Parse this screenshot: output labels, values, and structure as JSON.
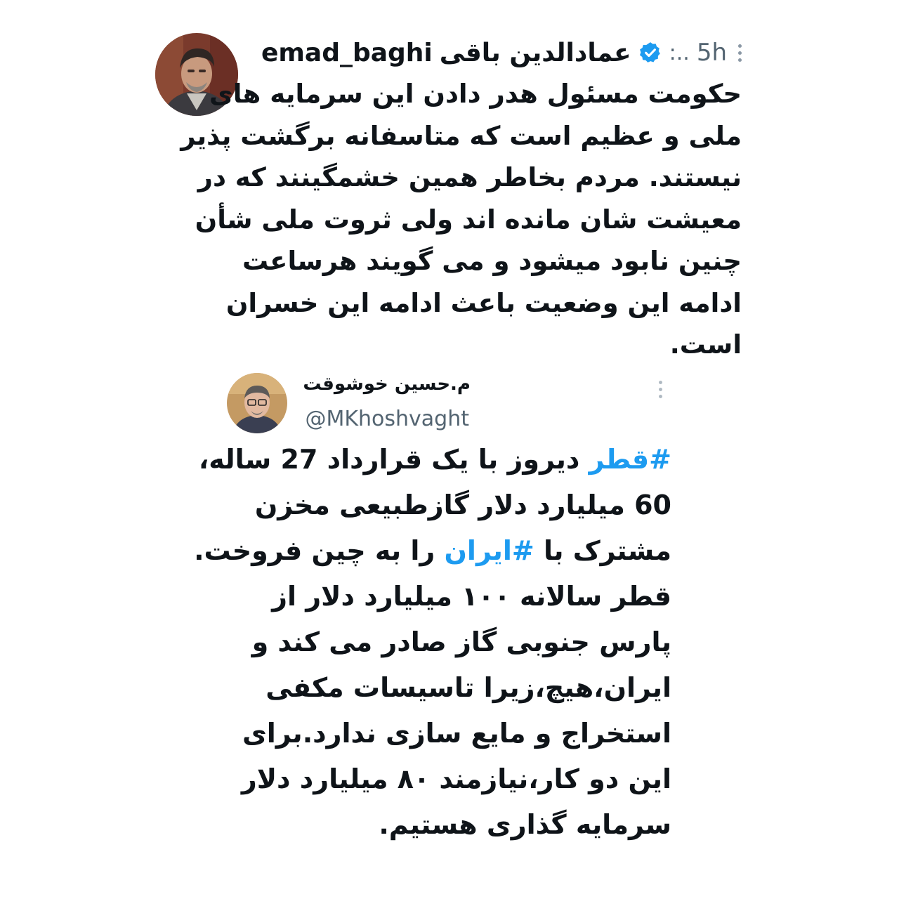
{
  "tweet": {
    "handle": "emad_baghi",
    "display_name": "عمادالدین باقی",
    "dots": ":..",
    "time": "5h",
    "lines": [
      "حکومت مسئول هدر دادن این سرمایه های",
      "ملی و عظیم است که متاسفانه برگشت پذیر",
      "نیستند. مردم بخاطر همین خشمگینند که در",
      "معیشت شان مانده اند ولی ثروت ملی شأن",
      "چنین نابود میشود و می گویند هرساعت",
      "ادامه این وضعیت باعث ادامه این خسران",
      "است."
    ]
  },
  "quoted_tweet": {
    "display_name": "م.حسین خوشوقت",
    "handle": "@MKhoshvaght",
    "line1_hashtag": "#قطر",
    "line1_rest": " دیروز با یک قرارداد 27 ساله،",
    "line2": "60 میلیارد دلار گازطبیعی مخزن",
    "line3_before": "مشترک با ",
    "line3_hashtag": "#ایران",
    "line3_after": " را به چین فروخت.",
    "lines_rest": [
      "قطر سالانه ۱۰۰ میلیارد دلار از",
      "پارس جنوبی گاز صادر می کند و",
      "ایران،هیچ،زیرا تاسیسات مکفی",
      "استخراج و مایع سازی ندارد.برای",
      "این دو کار،نیازمند ۸۰ میلیارد دلار",
      "سرمایه گذاری هستیم."
    ]
  },
  "colors": {
    "hashtag": "#1d9bf0",
    "verified": "#1d9bf0",
    "secondary_text": "#536471"
  },
  "icons": [
    "more-options-icon",
    "verified-badge-icon",
    "avatar"
  ]
}
